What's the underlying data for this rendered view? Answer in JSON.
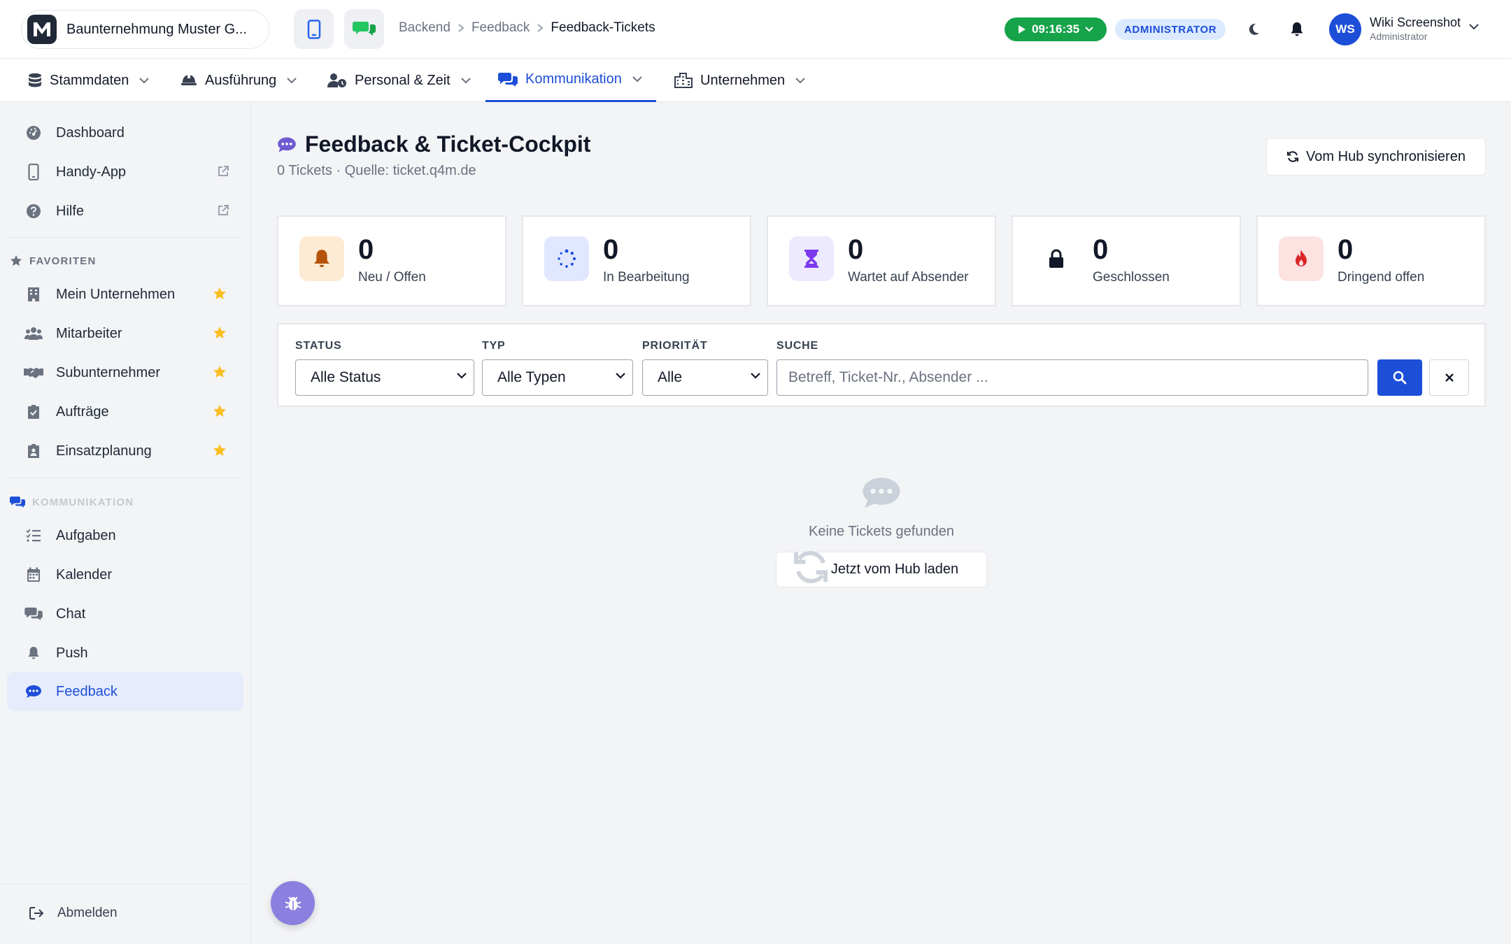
{
  "company": {
    "name": "Baunternehmung Muster G..."
  },
  "breadcrumb": [
    "Backend",
    "Feedback",
    "Feedback-Tickets"
  ],
  "timer": {
    "value": "09:16:35"
  },
  "role_badge": "ADMINISTRATOR",
  "user": {
    "initials": "WS",
    "name": "Wiki Screenshot",
    "role": "Administrator"
  },
  "mainnav": {
    "items": [
      {
        "label": "Stammdaten"
      },
      {
        "label": "Ausführung"
      },
      {
        "label": "Personal & Zeit"
      },
      {
        "label": "Kommunikation"
      },
      {
        "label": "Unternehmen"
      }
    ],
    "active": "Kommunikation"
  },
  "sidebar": {
    "top": [
      {
        "label": "Dashboard"
      },
      {
        "label": "Handy-App"
      },
      {
        "label": "Hilfe"
      }
    ],
    "favorites_title": "FAVORITEN",
    "favorites": [
      {
        "label": "Mein Unternehmen"
      },
      {
        "label": "Mitarbeiter"
      },
      {
        "label": "Subunternehmer"
      },
      {
        "label": "Aufträge"
      },
      {
        "label": "Einsatzplanung"
      }
    ],
    "section_title": "KOMMUNIKATION",
    "section_items": [
      {
        "label": "Aufgaben"
      },
      {
        "label": "Kalender"
      },
      {
        "label": "Chat"
      },
      {
        "label": "Push"
      },
      {
        "label": "Feedback"
      }
    ],
    "logout": "Abmelden"
  },
  "page": {
    "title": "Feedback & Ticket-Cockpit",
    "subtitle": "0 Tickets · Quelle: ticket.q4m.de",
    "sync_button": "Vom Hub synchronisieren"
  },
  "stats": [
    {
      "value": "0",
      "label": "Neu / Offen",
      "color": "#b45309"
    },
    {
      "value": "0",
      "label": "In Bearbeitung",
      "color": "#1d4ed8"
    },
    {
      "value": "0",
      "label": "Wartet auf Absender",
      "color": "#7c3aed"
    },
    {
      "value": "0",
      "label": "Geschlossen",
      "color": "#111827"
    },
    {
      "value": "0",
      "label": "Dringend offen",
      "color": "#dc2626"
    }
  ],
  "filters": {
    "status_label": "STATUS",
    "status_value": "Alle Status",
    "type_label": "TYP",
    "type_value": "Alle Typen",
    "priority_label": "PRIORITÄT",
    "priority_value": "Alle",
    "search_label": "SUCHE",
    "search_placeholder": "Betreff, Ticket-Nr., Absender ..."
  },
  "empty": {
    "text": "Keine Tickets gefunden",
    "button": "Jetzt vom Hub laden"
  },
  "colors": {
    "accent": "#1d4ed8",
    "timer": "#16a34a",
    "star": "#fbbf24"
  }
}
